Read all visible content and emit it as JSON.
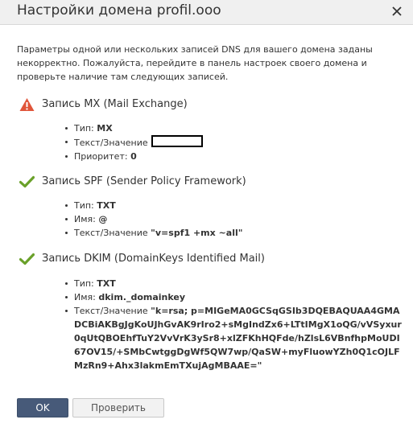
{
  "dialog": {
    "title": "Настройки домена profil.ooo",
    "intro": "Параметры одной или нескольких записей DNS для вашего домена заданы некорректно. Пожалуйста, перейдите в панель настроек своего домена и проверьте наличие там следующих записей."
  },
  "records": [
    {
      "status": "error",
      "icon": "warning-icon",
      "heading": "Запись MX (Mail Exchange)",
      "fields": [
        {
          "label": "Тип: ",
          "value": "MX"
        },
        {
          "label": "Текст/Значение ",
          "value": ""
        },
        {
          "label": "Приоритет: ",
          "value": "0"
        }
      ]
    },
    {
      "status": "ok",
      "icon": "checkmark-icon",
      "heading": "Запись SPF (Sender Policy Framework)",
      "fields": [
        {
          "label": "Тип: ",
          "value": "TXT"
        },
        {
          "label": "Имя: ",
          "value": "@"
        },
        {
          "label": "Текст/Значение ",
          "value": "\"v=spf1 +mx ~all\""
        }
      ]
    },
    {
      "status": "ok",
      "icon": "checkmark-icon",
      "heading": "Запись DKIM (DomainKeys Identified Mail)",
      "fields": [
        {
          "label": "Тип: ",
          "value": "TXT"
        },
        {
          "label": "Имя: ",
          "value": "dkim._domainkey"
        },
        {
          "label": "Текст/Значение ",
          "value": "\"k=rsa; p=MIGeMA0GCSqGSIb3DQEBAQUAA4GMADCBiAKBgJgKoUJhGvAK9rIro2+sMgIndZx6+LTtIMgX1oQG/vVSyxur0qUtQBOEhfTuY2VvVrK3ySr8+xlZFKhHQFde/hZlsL6VBnfhpMoUDI67OV15/+SMbCwtggDgWf5QW7wp/QaSW+myFluowYZh0Q1cOJLFMzRn9+Ahx3lakmEmTXujAgMBAAE=\""
        }
      ]
    }
  ],
  "buttons": {
    "ok": "OK",
    "check": "Проверить"
  },
  "colors": {
    "warning": "#e0553a",
    "check": "#6aa12a",
    "primary_button": "#475a79"
  }
}
